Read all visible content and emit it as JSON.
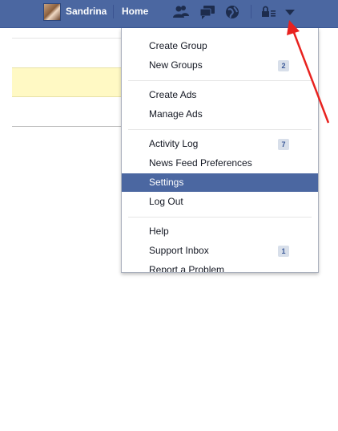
{
  "topbar": {
    "user_name": "Sandrina",
    "home_label": "Home",
    "icons": [
      "friend-requests-icon",
      "messages-icon",
      "notifications-globe-icon",
      "privacy-shortcuts-icon",
      "account-menu-arrow-icon"
    ]
  },
  "menu": {
    "groups": [
      {
        "items": [
          {
            "label": "Create Group"
          },
          {
            "label": "New Groups",
            "badge": "2"
          }
        ]
      },
      {
        "items": [
          {
            "label": "Create Ads"
          },
          {
            "label": "Manage Ads"
          }
        ]
      },
      {
        "items": [
          {
            "label": "Activity Log",
            "badge": "7"
          },
          {
            "label": "News Feed Preferences"
          },
          {
            "label": "Settings",
            "selected": true
          },
          {
            "label": "Log Out"
          }
        ]
      },
      {
        "items": [
          {
            "label": "Help"
          },
          {
            "label": "Support Inbox",
            "badge": "1"
          },
          {
            "label": "Report a Problem"
          }
        ]
      }
    ]
  },
  "colors": {
    "topbar": "#4b67a1",
    "selected": "#4b67a1",
    "badge_bg": "#d8dfea",
    "annotation": "#e8221f"
  }
}
